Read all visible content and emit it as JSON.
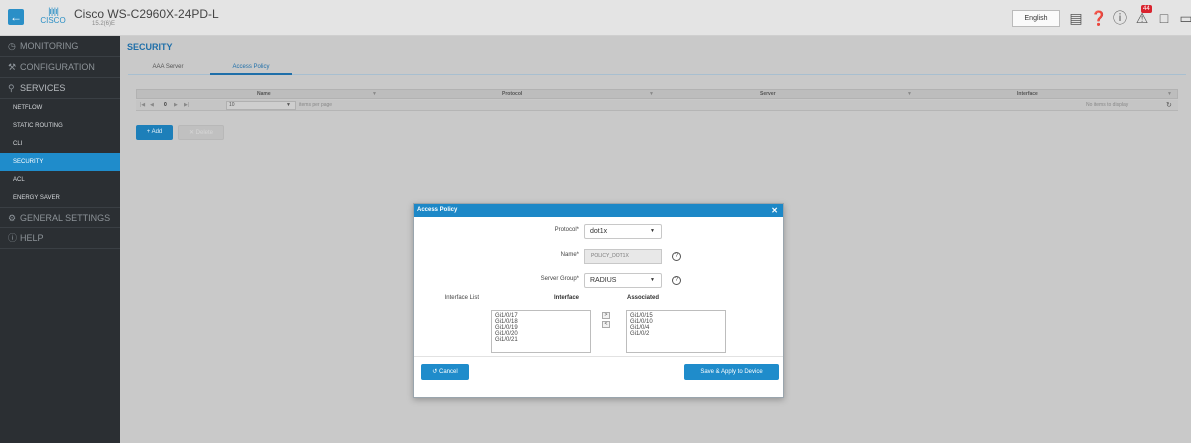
{
  "header": {
    "logo_text": "CISCO",
    "device_title": "Cisco WS-C2960X-24PD-L",
    "device_subtitle": "15.2(6)E",
    "language": "English",
    "alert_count": "44"
  },
  "sidebar": {
    "sections": [
      {
        "label": "MONITORING",
        "icon": "monitoring-icon"
      },
      {
        "label": "CONFIGURATION",
        "icon": "wrench-icon"
      },
      {
        "label": "SERVICES",
        "icon": "services-icon"
      }
    ],
    "services_items": [
      "NETFLOW",
      "STATIC ROUTING",
      "CLI",
      "SECURITY",
      "ACL",
      "ENERGY SAVER"
    ],
    "active_item": "SECURITY",
    "general_settings": "GENERAL SETTINGS",
    "help": "HELP"
  },
  "main": {
    "page_title": "SECURITY",
    "tabs": [
      "AAA Server",
      "Access Policy"
    ],
    "active_tab": "Access Policy",
    "grid": {
      "columns": [
        "Name",
        "Protocol",
        "Server",
        "Interface"
      ],
      "pager": {
        "page": "0",
        "page_size": "10",
        "items_per_page_label": "items per page",
        "empty_text": "No items to display"
      }
    },
    "add_label": "+ Add",
    "delete_label": "✕ Delete"
  },
  "modal": {
    "title": "Access Policy",
    "protocol_label": "Protocol*",
    "protocol_value": "dot1x",
    "name_label": "Name*",
    "name_value": "POLICY_DOT1X",
    "server_group_label": "Server Group*",
    "server_group_value": "RADIUS",
    "interface_list_label": "Interface List",
    "interface_head": "Interface",
    "associated_head": "Associated",
    "interfaces": [
      "Gi1/0/17",
      "Gi1/0/18",
      "Gi1/0/19",
      "Gi1/0/20",
      "Gi1/0/21"
    ],
    "associated": [
      "Gi1/0/15",
      "Gi1/0/10",
      "Gi1/0/4",
      "Gi1/0/2"
    ],
    "move_right": ">",
    "move_left": "<",
    "cancel_label": "Cancel",
    "save_label": "Save & Apply to Device"
  },
  "colors": {
    "accent": "#1f8ccb",
    "sidebar_bg": "#2b2f33",
    "alert": "#d9232e"
  }
}
